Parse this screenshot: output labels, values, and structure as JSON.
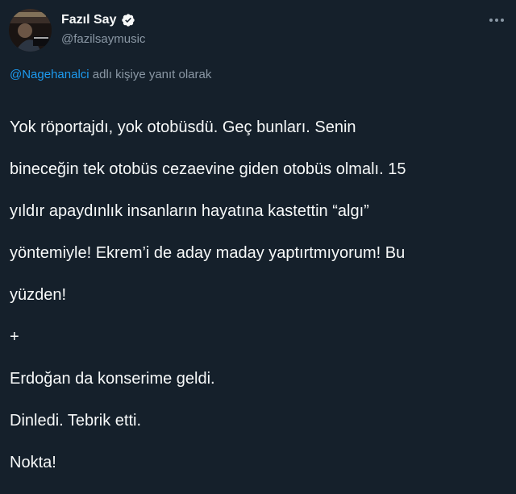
{
  "author": {
    "display_name": "Fazıl Say",
    "handle": "@fazilsaymusic",
    "verified": true
  },
  "reply_context": {
    "mention": "@Nagehanalci",
    "suffix": "adlı kişiye yanıt olarak"
  },
  "tweet": {
    "lines": [
      "Yok röportajdı, yok otobüsdü. Geç bunları. Senin",
      "bineceğin tek otobüs cezaevine giden otobüs olmalı. 15",
      "yıldır apaydınlık insanların hayatına kastettin “algı”",
      "yöntemiyle! Ekrem’i de aday maday yaptırtmıyorum! Bu",
      "yüzden!",
      "+",
      "Erdoğan da konserime geldi.",
      "Dinledi. Tebrik etti.",
      "Nokta!"
    ]
  },
  "icons": {
    "verified": "verified-badge-icon",
    "more": "more-options-icon"
  },
  "colors": {
    "background": "#15202b",
    "text": "#f7f9f9",
    "muted": "#8b98a5",
    "accent": "#1d9bf0"
  }
}
